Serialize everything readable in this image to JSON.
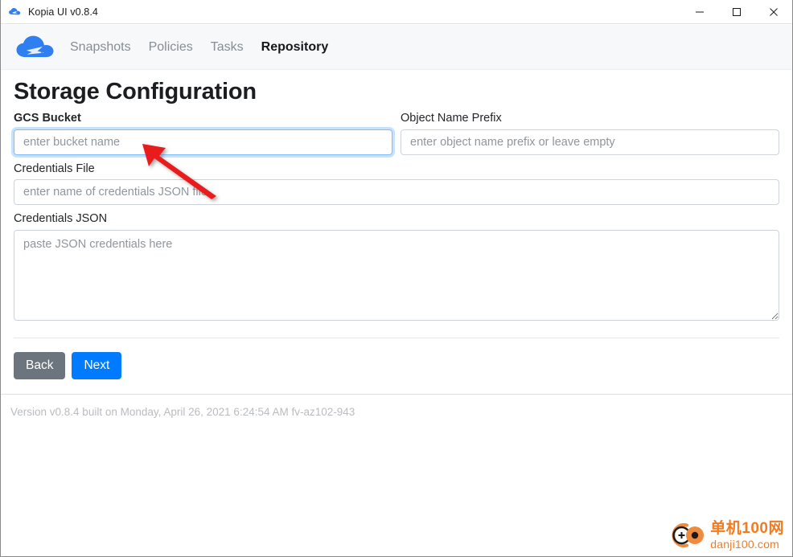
{
  "window": {
    "title": "Kopia UI v0.8.4",
    "app_icon": "cloud-icon",
    "controls": [
      {
        "name": "minimize-button",
        "glyph": "minimize-icon"
      },
      {
        "name": "maximize-button",
        "glyph": "maximize-icon"
      },
      {
        "name": "close-button",
        "glyph": "close-icon"
      }
    ]
  },
  "navbar": {
    "brand_icon": "kopia-cloud-logo",
    "links": [
      {
        "label": "Snapshots",
        "active": false
      },
      {
        "label": "Policies",
        "active": false
      },
      {
        "label": "Tasks",
        "active": false
      },
      {
        "label": "Repository",
        "active": true
      }
    ]
  },
  "main": {
    "page_title": "Storage Configuration",
    "fields": {
      "gcs_bucket": {
        "label": "GCS Bucket",
        "placeholder": "enter bucket name",
        "value": "",
        "focused": true
      },
      "object_name_prefix": {
        "label": "Object Name Prefix",
        "placeholder": "enter object name prefix or leave empty",
        "value": "",
        "focused": false
      },
      "credentials_file": {
        "label": "Credentials File",
        "placeholder": "enter name of credentials JSON file",
        "value": "",
        "focused": false
      },
      "credentials_json": {
        "label": "Credentials JSON",
        "placeholder": "paste JSON credentials here",
        "value": "",
        "focused": false
      }
    },
    "buttons": {
      "back": "Back",
      "next": "Next"
    }
  },
  "footer": {
    "version_text": "Version v0.8.4 built on Monday, April 26, 2021 6:24:54 AM fv-az102-943"
  },
  "annotation": {
    "type": "red-arrow",
    "color": "#e81b1b",
    "points_to": "gcs-bucket-input"
  },
  "watermark": {
    "name_cn": "单机100网",
    "url": "danji100.com",
    "color": "#f07c22"
  }
}
